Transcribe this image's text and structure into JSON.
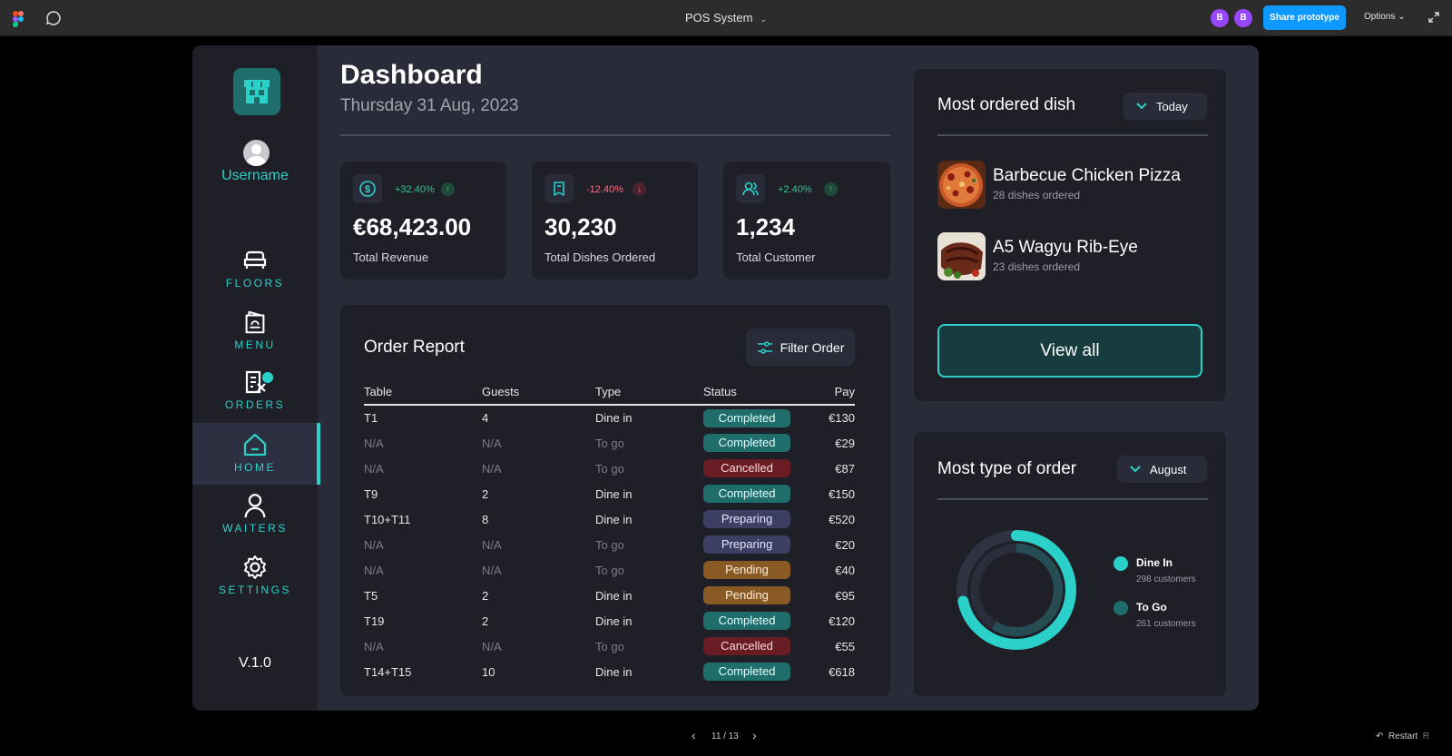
{
  "topbar": {
    "title": "POS System",
    "avatars": [
      "B",
      "B"
    ],
    "share_label": "Share prototype",
    "options_label": "Options"
  },
  "sidebar": {
    "username": "Username",
    "nav": [
      {
        "label": "FLOORS",
        "icon": "sofa-icon"
      },
      {
        "label": "MENU",
        "icon": "menu-book-icon"
      },
      {
        "label": "ORDERS",
        "icon": "orders-icon",
        "badge": ""
      },
      {
        "label": "HOME",
        "icon": "home-icon",
        "active": true
      },
      {
        "label": "WAITERS",
        "icon": "person-icon"
      },
      {
        "label": "SETTINGS",
        "icon": "gear-icon"
      }
    ],
    "version": "V.1.0"
  },
  "header": {
    "title": "Dashboard",
    "date": "Thursday 31 Aug, 2023"
  },
  "stats": [
    {
      "change": "+32.40%",
      "direction": "up",
      "value": "€68,423.00",
      "label": "Total Revenue",
      "icon": "dollar-icon"
    },
    {
      "change": "-12.40%",
      "direction": "down",
      "value": "30,230",
      "label": "Total Dishes Ordered",
      "icon": "bookmark-icon"
    },
    {
      "change": "+2.40%",
      "direction": "up",
      "value": "1,234",
      "label": "Total Customer",
      "icon": "users-icon"
    }
  ],
  "order_report": {
    "title": "Order Report",
    "filter_label": "Filter Order",
    "columns": [
      "Table",
      "Guests",
      "Type",
      "Status",
      "Pay"
    ],
    "rows": [
      {
        "table": "T1",
        "guests": "4",
        "type": "Dine in",
        "status": "Completed",
        "pay": "€130"
      },
      {
        "table": "N/A",
        "guests": "N/A",
        "type": "To go",
        "status": "Completed",
        "pay": "€29"
      },
      {
        "table": "N/A",
        "guests": "N/A",
        "type": "To go",
        "status": "Cancelled",
        "pay": "€87"
      },
      {
        "table": "T9",
        "guests": "2",
        "type": "Dine in",
        "status": "Completed",
        "pay": "€150"
      },
      {
        "table": "T10+T11",
        "guests": "8",
        "type": "Dine in",
        "status": "Preparing",
        "pay": "€520"
      },
      {
        "table": "N/A",
        "guests": "N/A",
        "type": "To go",
        "status": "Preparing",
        "pay": "€20"
      },
      {
        "table": "N/A",
        "guests": "N/A",
        "type": "To go",
        "status": "Pending",
        "pay": "€40"
      },
      {
        "table": "T5",
        "guests": "2",
        "type": "Dine in",
        "status": "Pending",
        "pay": "€95"
      },
      {
        "table": "T19",
        "guests": "2",
        "type": "Dine in",
        "status": "Completed",
        "pay": "€120"
      },
      {
        "table": "N/A",
        "guests": "N/A",
        "type": "To go",
        "status": "Cancelled",
        "pay": "€55"
      },
      {
        "table": "T14+T15",
        "guests": "10",
        "type": "Dine in",
        "status": "Completed",
        "pay": "€618"
      }
    ]
  },
  "most_ordered": {
    "title": "Most ordered dish",
    "period": "Today",
    "dishes": [
      {
        "name": "Barbecue Chicken Pizza",
        "sub": "28 dishes ordered"
      },
      {
        "name": "A5 Wagyu Rib-Eye",
        "sub": "23 dishes ordered"
      }
    ],
    "view_all": "View all"
  },
  "order_type": {
    "title": "Most type of order",
    "period": "August",
    "legend": [
      {
        "name": "Dine In",
        "sub": "298 customers",
        "color": "#2bd1c9"
      },
      {
        "name": "To Go",
        "sub": "261 customers",
        "color": "#1f6e6b"
      }
    ]
  },
  "footer": {
    "page": "11 / 13",
    "restart": "Restart",
    "restart_key": "R"
  },
  "colors": {
    "accent": "#2bd1c9",
    "panel": "#1f1f28",
    "bg": "#292c38"
  }
}
